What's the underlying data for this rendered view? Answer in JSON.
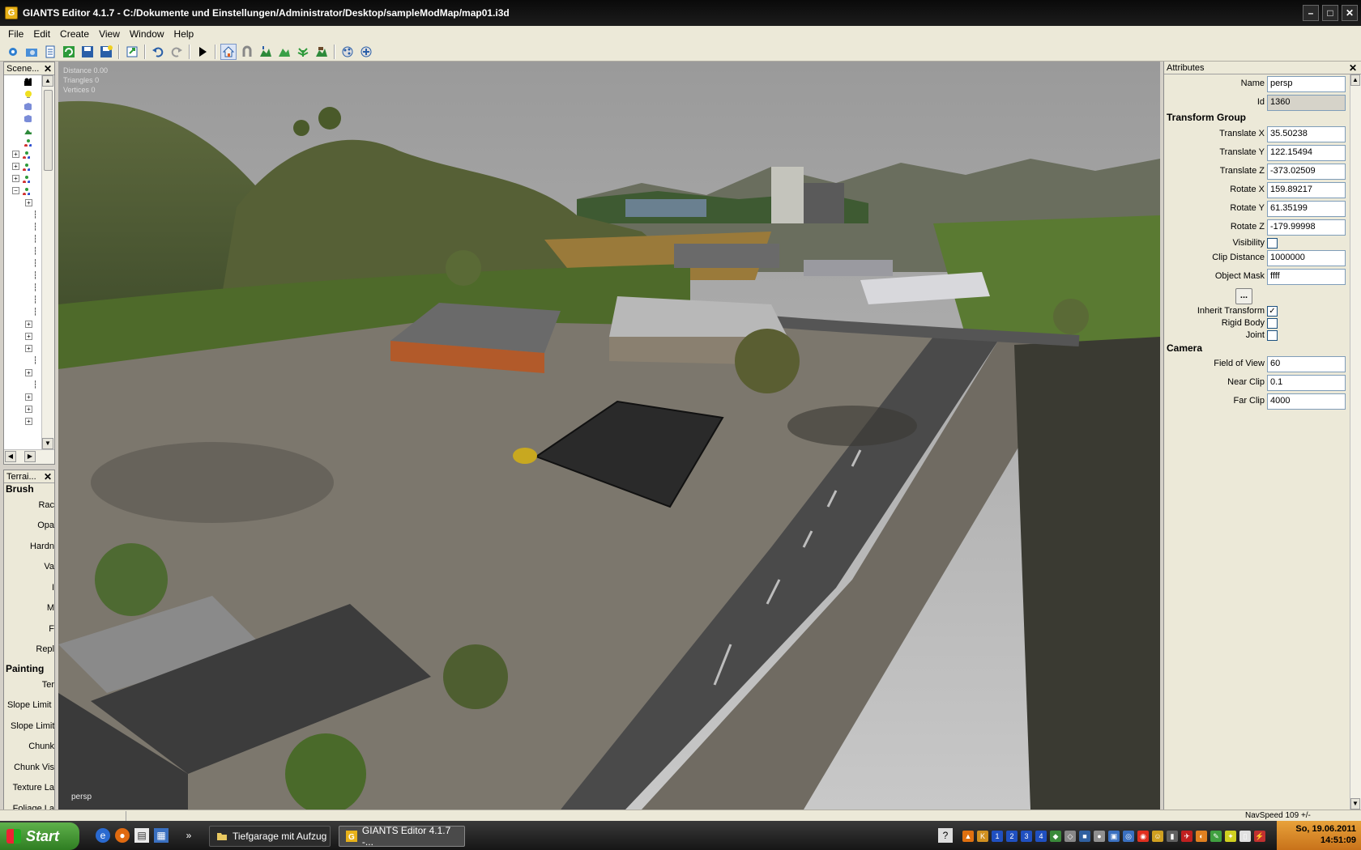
{
  "window": {
    "title": "GIANTS Editor 4.1.7 - C:/Dokumente und Einstellungen/Administrator/Desktop/sampleModMap/map01.i3d",
    "app_icon": "G"
  },
  "menu": [
    "File",
    "Edit",
    "Create",
    "View",
    "Window",
    "Help"
  ],
  "toolbar_icons": [
    "new-icon",
    "open-icon",
    "list-icon",
    "reload-icon",
    "save-icon",
    "save-all-icon",
    "export-icon",
    "undo-icon",
    "redo-icon",
    "play-icon",
    "home-icon",
    "magnet-icon",
    "terrain-raise-icon",
    "terrain-paint-icon",
    "foliage-icon",
    "terrain-lower-icon",
    "particle-icon",
    "physics-icon"
  ],
  "scene_panel": {
    "title": "Scene...",
    "close": "✕"
  },
  "terrain_panel": {
    "title": "Terrai...",
    "close": "✕",
    "brush_heading": "Brush",
    "brush_rows": [
      "Rac",
      "Opa",
      "Hardn",
      "Va",
      "I",
      "M",
      "F",
      "Repl"
    ],
    "painting_heading": "Painting",
    "painting_rows": [
      "Ter",
      "Slope Limit S",
      "Slope Limit",
      "Chunk",
      "Chunk Vis",
      "Texture La",
      "Foliage La"
    ]
  },
  "viewport": {
    "distance": "Distance 0.00",
    "triangles": "Triangles 0",
    "vertices": "Vertices 0",
    "camera_label": "persp"
  },
  "attributes": {
    "title": "Attributes",
    "close": "✕",
    "name_label": "Name",
    "name_value": "persp",
    "id_label": "Id",
    "id_value": "1360",
    "transform_heading": "Transform Group",
    "translate_x_label": "Translate X",
    "translate_x": "35.50238",
    "translate_y_label": "Translate Y",
    "translate_y": "122.15494",
    "translate_z_label": "Translate Z",
    "translate_z": "-373.02509",
    "rotate_x_label": "Rotate X",
    "rotate_x": "159.89217",
    "rotate_y_label": "Rotate Y",
    "rotate_y": "61.35199",
    "rotate_z_label": "Rotate Z",
    "rotate_z": "-179.99998",
    "visibility_label": "Visibility",
    "visibility_checked": false,
    "clip_distance_label": "Clip Distance",
    "clip_distance": "1000000",
    "object_mask_label": "Object Mask",
    "object_mask": "ffff",
    "dots_button": "...",
    "inherit_transform_label": "Inherit Transform",
    "inherit_transform_mark": "✓",
    "rigid_body_label": "Rigid Body",
    "joint_label": "Joint",
    "camera_heading": "Camera",
    "fov_label": "Field of View",
    "fov": "60",
    "near_clip_label": "Near Clip",
    "near_clip": "0.1",
    "far_clip_label": "Far Clip",
    "far_clip": "4000"
  },
  "status": {
    "navspeed": "NavSpeed 109 +/-"
  },
  "taskbar": {
    "start": "Start",
    "more": "»",
    "task1": "Tiefgarage mit Aufzug",
    "task2": "GIANTS Editor 4.1.7 -...",
    "help": "?",
    "date": "So, 19.06.2011",
    "time": "14:51:09"
  },
  "colors": {
    "titlebar": "#111111",
    "chrome": "#ece9d8",
    "clock_bg": "#e09030",
    "start_green": "#3f9a2e"
  }
}
